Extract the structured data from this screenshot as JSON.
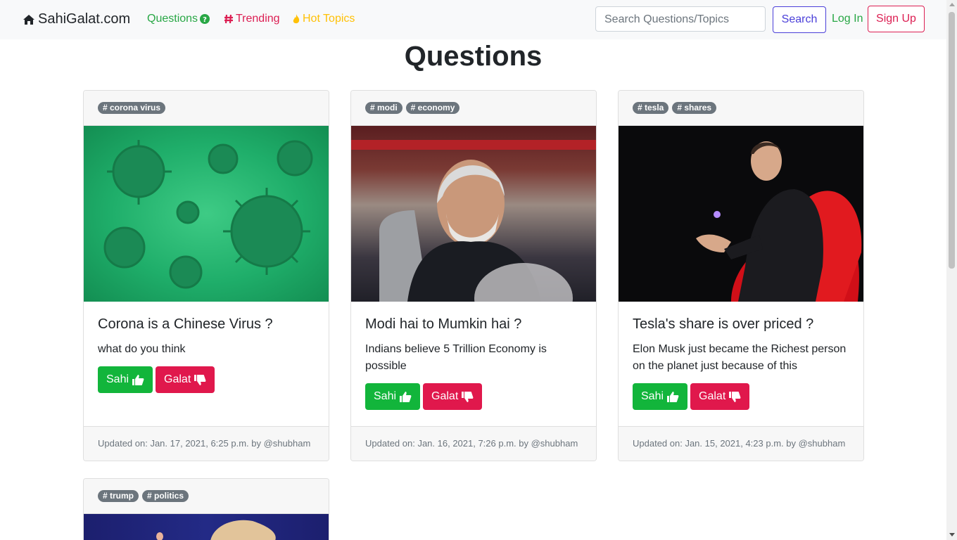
{
  "nav": {
    "brand": "SahiGalat.com",
    "questions": "Questions",
    "trending": "Trending",
    "hot_topics": "Hot Topics",
    "search_placeholder": "Search Questions/Topics",
    "search_button": "Search",
    "login": "Log In",
    "signup": "Sign Up"
  },
  "page_title": "Questions",
  "cards": [
    {
      "tags": [
        "# corona virus"
      ],
      "title": "Corona is a Chinese Virus ?",
      "text": "what do you think",
      "sahi": "Sahi",
      "galat": "Galat",
      "footer": "Updated on: Jan. 17, 2021, 6:25 p.m. by @shubham"
    },
    {
      "tags": [
        "# modi",
        "# economy"
      ],
      "title": "Modi hai to Mumkin hai ?",
      "text": "Indians believe 5 Trillion Economy is possible",
      "sahi": "Sahi",
      "galat": "Galat",
      "footer": "Updated on: Jan. 16, 2021, 7:26 p.m. by @shubham"
    },
    {
      "tags": [
        "# tesla",
        "# shares"
      ],
      "title": "Tesla's share is over priced ?",
      "text": "Elon Musk just became the Richest person on the planet just because of this",
      "sahi": "Sahi",
      "galat": "Galat",
      "footer": "Updated on: Jan. 15, 2021, 4:23 p.m. by @shubham"
    },
    {
      "tags": [
        "# trump",
        "# politics"
      ]
    }
  ],
  "colors": {
    "sahi": "#12b53b",
    "galat": "#e0184c",
    "questions_link": "#28a745",
    "trending_link": "#dc1e52",
    "hot_topics_link": "#ffc107"
  },
  "icons": [
    "home-icon",
    "question-circle-icon",
    "hashtag-icon",
    "fire-icon",
    "thumbs-up-icon",
    "thumbs-down-icon"
  ]
}
